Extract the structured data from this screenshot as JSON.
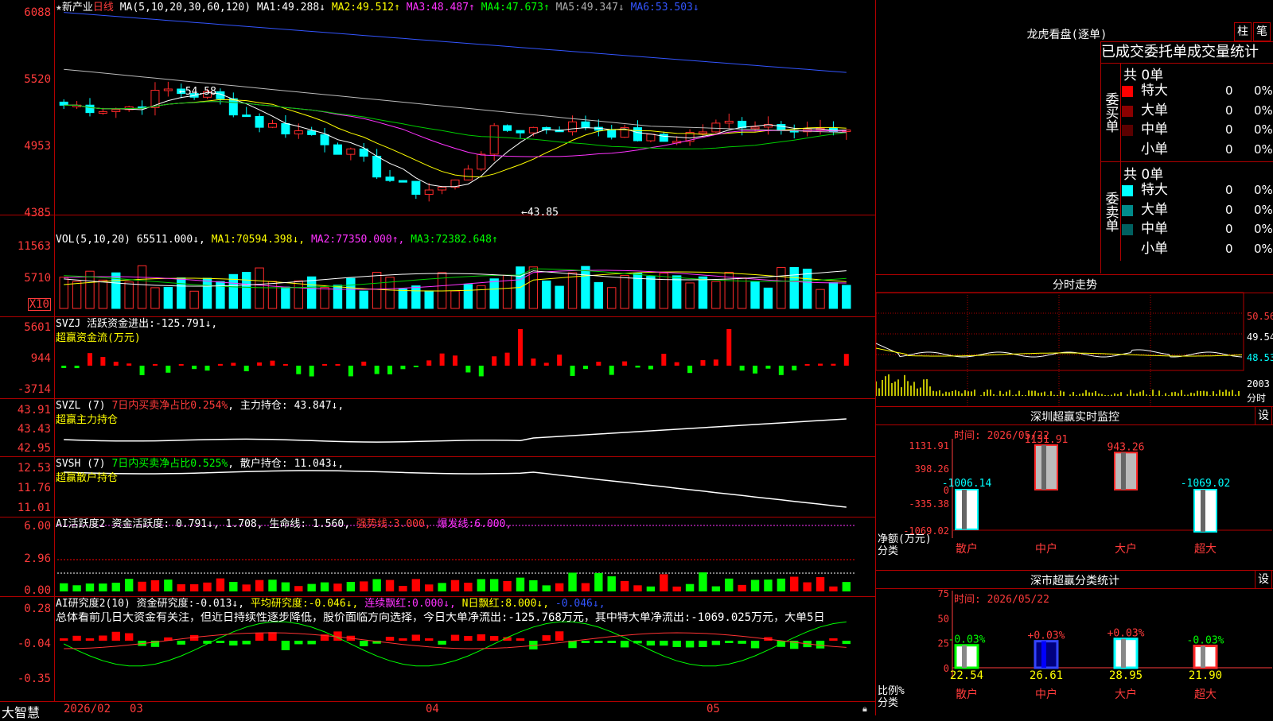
{
  "app_name": "大智慧",
  "main": {
    "title": "新产业",
    "period": "日线",
    "ma_spec": "MA(5,10,20,30,60,120)",
    "ma": [
      {
        "label": "MA1:",
        "value": "49.288↓",
        "color": "#ffffff"
      },
      {
        "label": "MA2:",
        "value": "49.512↑",
        "color": "#ffff00"
      },
      {
        "label": "MA3:",
        "value": "48.487↑",
        "color": "#ff33ff"
      },
      {
        "label": "MA4:",
        "value": "47.673↑",
        "color": "#00ff00"
      },
      {
        "label": "MA5:",
        "value": "49.347↓",
        "color": "#aaaaaa"
      },
      {
        "label": "MA6:",
        "value": "53.503↓",
        "color": "#3355ff"
      }
    ],
    "yticks": [
      "6088",
      "5520",
      "4953",
      "4385"
    ],
    "high_label": "←54.58",
    "low_label": "←43.85"
  },
  "vol": {
    "spec": "VOL(5,10,20)",
    "value": "65511.000↓",
    "ma1": "70594.398↓",
    "ma2": "77350.000↑",
    "ma3": "72382.648↑",
    "yticks": [
      "11563",
      "5710"
    ],
    "unit": "X10"
  },
  "svzj": {
    "name": "SVZJ",
    "label": "活跃资金进出:",
    "value": "-125.791↓",
    "sub": "超赢资金流(万元)",
    "yticks": [
      "5601",
      "944",
      "-3714"
    ]
  },
  "svzl": {
    "name": "SVZL (7)",
    "label1": "7日内买卖净占比0.254%",
    "label2": "主力持仓:",
    "value": "43.847↓,",
    "sub": "超赢主力持仓",
    "yticks": [
      "43.91",
      "43.43",
      "42.95"
    ]
  },
  "svsh": {
    "name": "SVSH (7)",
    "label1": "7日内买卖净占比0.525%",
    "label2": "散户持仓:",
    "value": "11.043↓,",
    "sub": "超赢散户持仓",
    "yticks": [
      "12.53",
      "11.76",
      "11.01"
    ]
  },
  "ai1": {
    "name": "AI活跃度2",
    "l1": "资金活跃度:",
    "v1": "0.791↓,",
    "v1b": "1.708,",
    "l2": "生命线:",
    "v2": "1.560,",
    "l3": "强势线:",
    "v3": "3.000,",
    "l4": "爆发线:",
    "v4": "6.000,",
    "yticks": [
      "6.00",
      "2.96",
      "0.00"
    ]
  },
  "ai2": {
    "name": "AI研究度2(10)",
    "l1": "资金研究度:",
    "v1": "-0.013↓,",
    "l2": "平均研究度:",
    "v2": "-0.046↓,",
    "l3": "连续飘红:",
    "v3": "0.000↓,",
    "l4": "N日飘红:",
    "v4": "8.000↓,",
    "v5": "-0.046↓,",
    "text": "总体看前几日大资金有关注，但近日持续性逐步降低，股价面临方向选择，今日大单净流出:-125.768万元，其中特大单净流出:-1069.025万元，大单5日",
    "yticks": [
      "0.28",
      "-0.04",
      "-0.35"
    ]
  },
  "xaxis": {
    "labels": [
      "2026/02",
      "03",
      "04",
      "05"
    ]
  },
  "dragon": {
    "title": "龙虎看盘(逐单)",
    "btn1": "柱",
    "btn2": "笔",
    "subtitle": "已成交委托单成交量统计",
    "buy_label": "委买单",
    "buy_total": "共 0单",
    "sell_label": "委卖单",
    "sell_total": "共 0单",
    "rows": [
      {
        "name": "特大",
        "count": "0",
        "pct": "0%"
      },
      {
        "name": "大单",
        "count": "0",
        "pct": "0%"
      },
      {
        "name": "中单",
        "count": "0",
        "pct": "0%"
      },
      {
        "name": "小单",
        "count": "0",
        "pct": "0%"
      }
    ],
    "buy_colors": [
      "#ff0000",
      "#8b0000",
      "#5a0000",
      ""
    ],
    "sell_colors": [
      "#00ffff",
      "#008b8b",
      "#006060",
      ""
    ]
  },
  "intraday": {
    "title": "分时走势",
    "yticks": [
      "50.56",
      "49.54",
      "48.53"
    ],
    "vol_label": "2003",
    "vol_unit": "分时"
  },
  "monitor": {
    "title": "深圳超赢实时监控",
    "gear": "设",
    "time": "时间: 2026/05/22",
    "yticks": [
      "1131.91",
      "398.26",
      "0",
      "-335.38",
      "-1069.02"
    ],
    "unit1": "净额(万元)",
    "unit2": "分类",
    "cats": [
      "散户",
      "中户",
      "大户",
      "超大"
    ],
    "values": [
      -1006.14,
      1131.91,
      943.26,
      -1069.02
    ],
    "value_labels": [
      "-1006.14",
      "1131.91",
      "943.26",
      "-1069.02"
    ]
  },
  "classify": {
    "title": "深市超赢分类统计",
    "gear": "设",
    "time": "时间: 2026/05/22",
    "yticks": [
      "75",
      "50",
      "25",
      "0"
    ],
    "unit1": "比例%",
    "unit2": "分类",
    "cats": [
      "散户",
      "中户",
      "大户",
      "超大"
    ],
    "change_labels": [
      "-0.03%",
      "+0.03%",
      "+0.03%",
      "-0.03%"
    ],
    "values": [
      22.54,
      26.61,
      28.95,
      21.9
    ],
    "value_labels": [
      "22.54",
      "26.61",
      "28.95",
      "21.90"
    ]
  }
}
